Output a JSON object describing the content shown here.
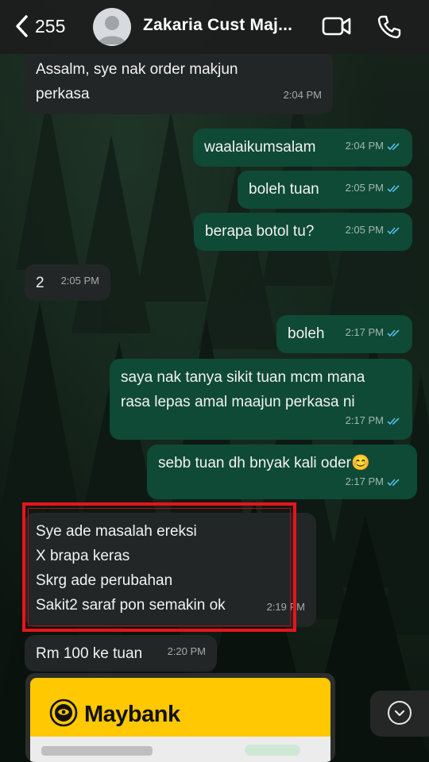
{
  "header": {
    "back_count": "255",
    "contact_name": "Zakaria Cust Maj..."
  },
  "messages": [
    {
      "dir": "in",
      "lines": [
        "Assalm, sye nak order makjun",
        "perkasa"
      ],
      "time": "2:04 PM"
    },
    {
      "dir": "out",
      "lines": [
        "waalaikumsalam"
      ],
      "time": "2:04 PM",
      "read": true
    },
    {
      "dir": "out",
      "lines": [
        "boleh tuan"
      ],
      "time": "2:05 PM",
      "read": true
    },
    {
      "dir": "out",
      "lines": [
        "berapa botol tu?"
      ],
      "time": "2:05 PM",
      "read": true
    },
    {
      "dir": "in",
      "lines": [
        "2"
      ],
      "time": "2:05 PM"
    },
    {
      "dir": "out",
      "lines": [
        "boleh"
      ],
      "time": "2:17 PM",
      "read": true
    },
    {
      "dir": "out",
      "lines": [
        "saya nak tanya sikit tuan mcm mana",
        "rasa lepas amal maajun perkasa ni"
      ],
      "time": "2:17 PM",
      "read": true
    },
    {
      "dir": "out",
      "lines": [
        "sebb tuan dh bnyak kali oder😊"
      ],
      "time": "2:17 PM",
      "read": true
    },
    {
      "dir": "in",
      "lines": [
        "Sye ade masalah ereksi",
        "X brapa keras",
        "Skrg ade perubahan",
        "Sakit2 saraf pon semakin ok"
      ],
      "time": "2:19 PM",
      "highlighted": true
    },
    {
      "dir": "in",
      "lines": [
        "Rm 100 ke tuan"
      ],
      "time": "2:20 PM"
    }
  ],
  "attachment": {
    "bank_name": "Maybank"
  },
  "colors": {
    "incoming_bubble": "#232626",
    "outgoing_bubble": "#0f4a36",
    "read_ticks": "#53bdeb",
    "highlight_box": "#e8141b",
    "maybank_yellow": "#ffc800"
  },
  "icons": {
    "back": "chevron-left-icon",
    "video": "video-camera-icon",
    "call": "phone-icon",
    "scroll": "chevron-down-icon"
  }
}
